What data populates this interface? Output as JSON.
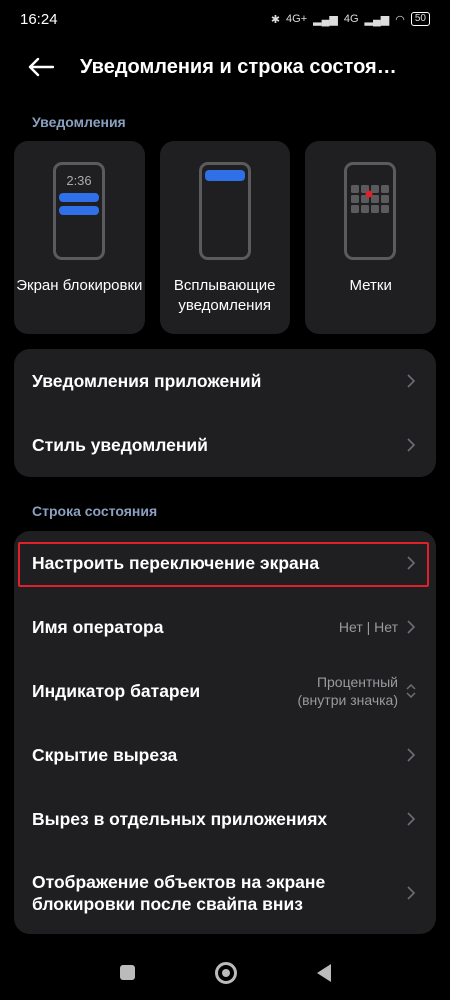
{
  "status_bar": {
    "time": "16:24",
    "network": "4G+",
    "network2": "4G",
    "battery": "50"
  },
  "header": {
    "title": "Уведомления и строка состоя…"
  },
  "notifications_section": {
    "label": "Уведомления",
    "tiles": [
      {
        "label": "Экран блокировки",
        "clock": "2:36"
      },
      {
        "label": "Всплывающие уведомления"
      },
      {
        "label": "Метки"
      }
    ],
    "rows": [
      {
        "label": "Уведомления приложений"
      },
      {
        "label": "Стиль уведомлений"
      }
    ]
  },
  "status_bar_section": {
    "label": "Строка состояния",
    "rows": [
      {
        "label": "Настроить переключение экрана",
        "value": ""
      },
      {
        "label": "Имя оператора",
        "value": "Нет | Нет"
      },
      {
        "label": "Индикатор батареи",
        "value": "Процентный (внутри значка)"
      },
      {
        "label": "Скрытие выреза",
        "value": ""
      },
      {
        "label": "Вырез в отдельных приложениях",
        "value": ""
      },
      {
        "label": "Отображение объектов на экране блокировки после свайпа вниз",
        "value": ""
      }
    ]
  },
  "colors": {
    "accent_blue": "#2f6fe8",
    "highlight_red": "#e0202a",
    "card_bg": "#1f1f22"
  }
}
